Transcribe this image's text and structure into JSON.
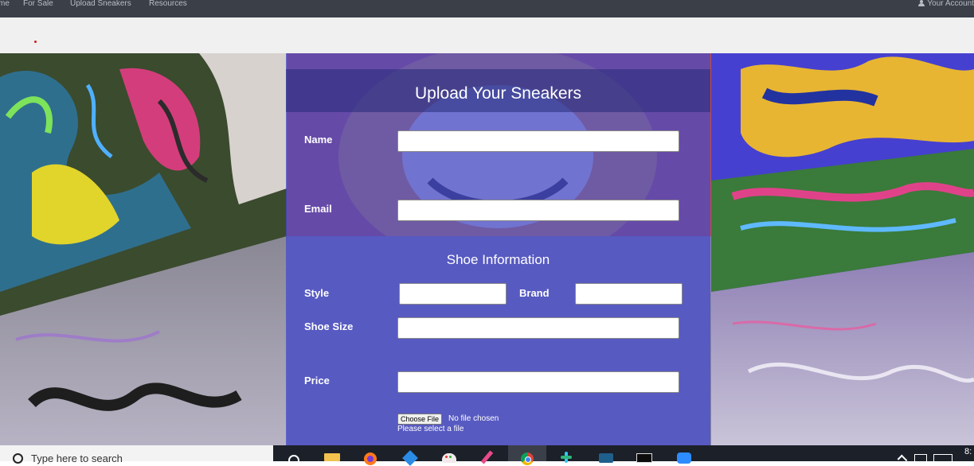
{
  "nav": {
    "items": [
      "me",
      "For Sale",
      "Upload Sneakers",
      "Resources"
    ],
    "account": "Your Account"
  },
  "form": {
    "title": "Upload Your Sneakers",
    "name_label": "Name",
    "email_label": "Email",
    "section_title": "Shoe Information",
    "style_label": "Style",
    "brand_label": "Brand",
    "size_label": "Shoe Size",
    "price_label": "Price",
    "file_button": "Choose File",
    "file_status": "No file chosen",
    "file_hint": "Please select a file",
    "name_value": "",
    "email_value": "",
    "style_value": "",
    "brand_value": "",
    "size_value": "",
    "price_value": ""
  },
  "taskbar": {
    "search_placeholder": "Type here to search",
    "clock": "8:",
    "icons": [
      "task-view-icon",
      "file-explorer-icon",
      "firefox-icon",
      "vscode-icon",
      "paint-icon",
      "pencil-app-icon",
      "chrome-icon",
      "slack-icon",
      "mysql-workbench-icon",
      "terminal-icon",
      "zoom-icon"
    ]
  },
  "colors": {
    "nav_bg": "#3a3f48",
    "panel_overlay": "#4248cd",
    "taskbar_bg": "#1c2029"
  }
}
